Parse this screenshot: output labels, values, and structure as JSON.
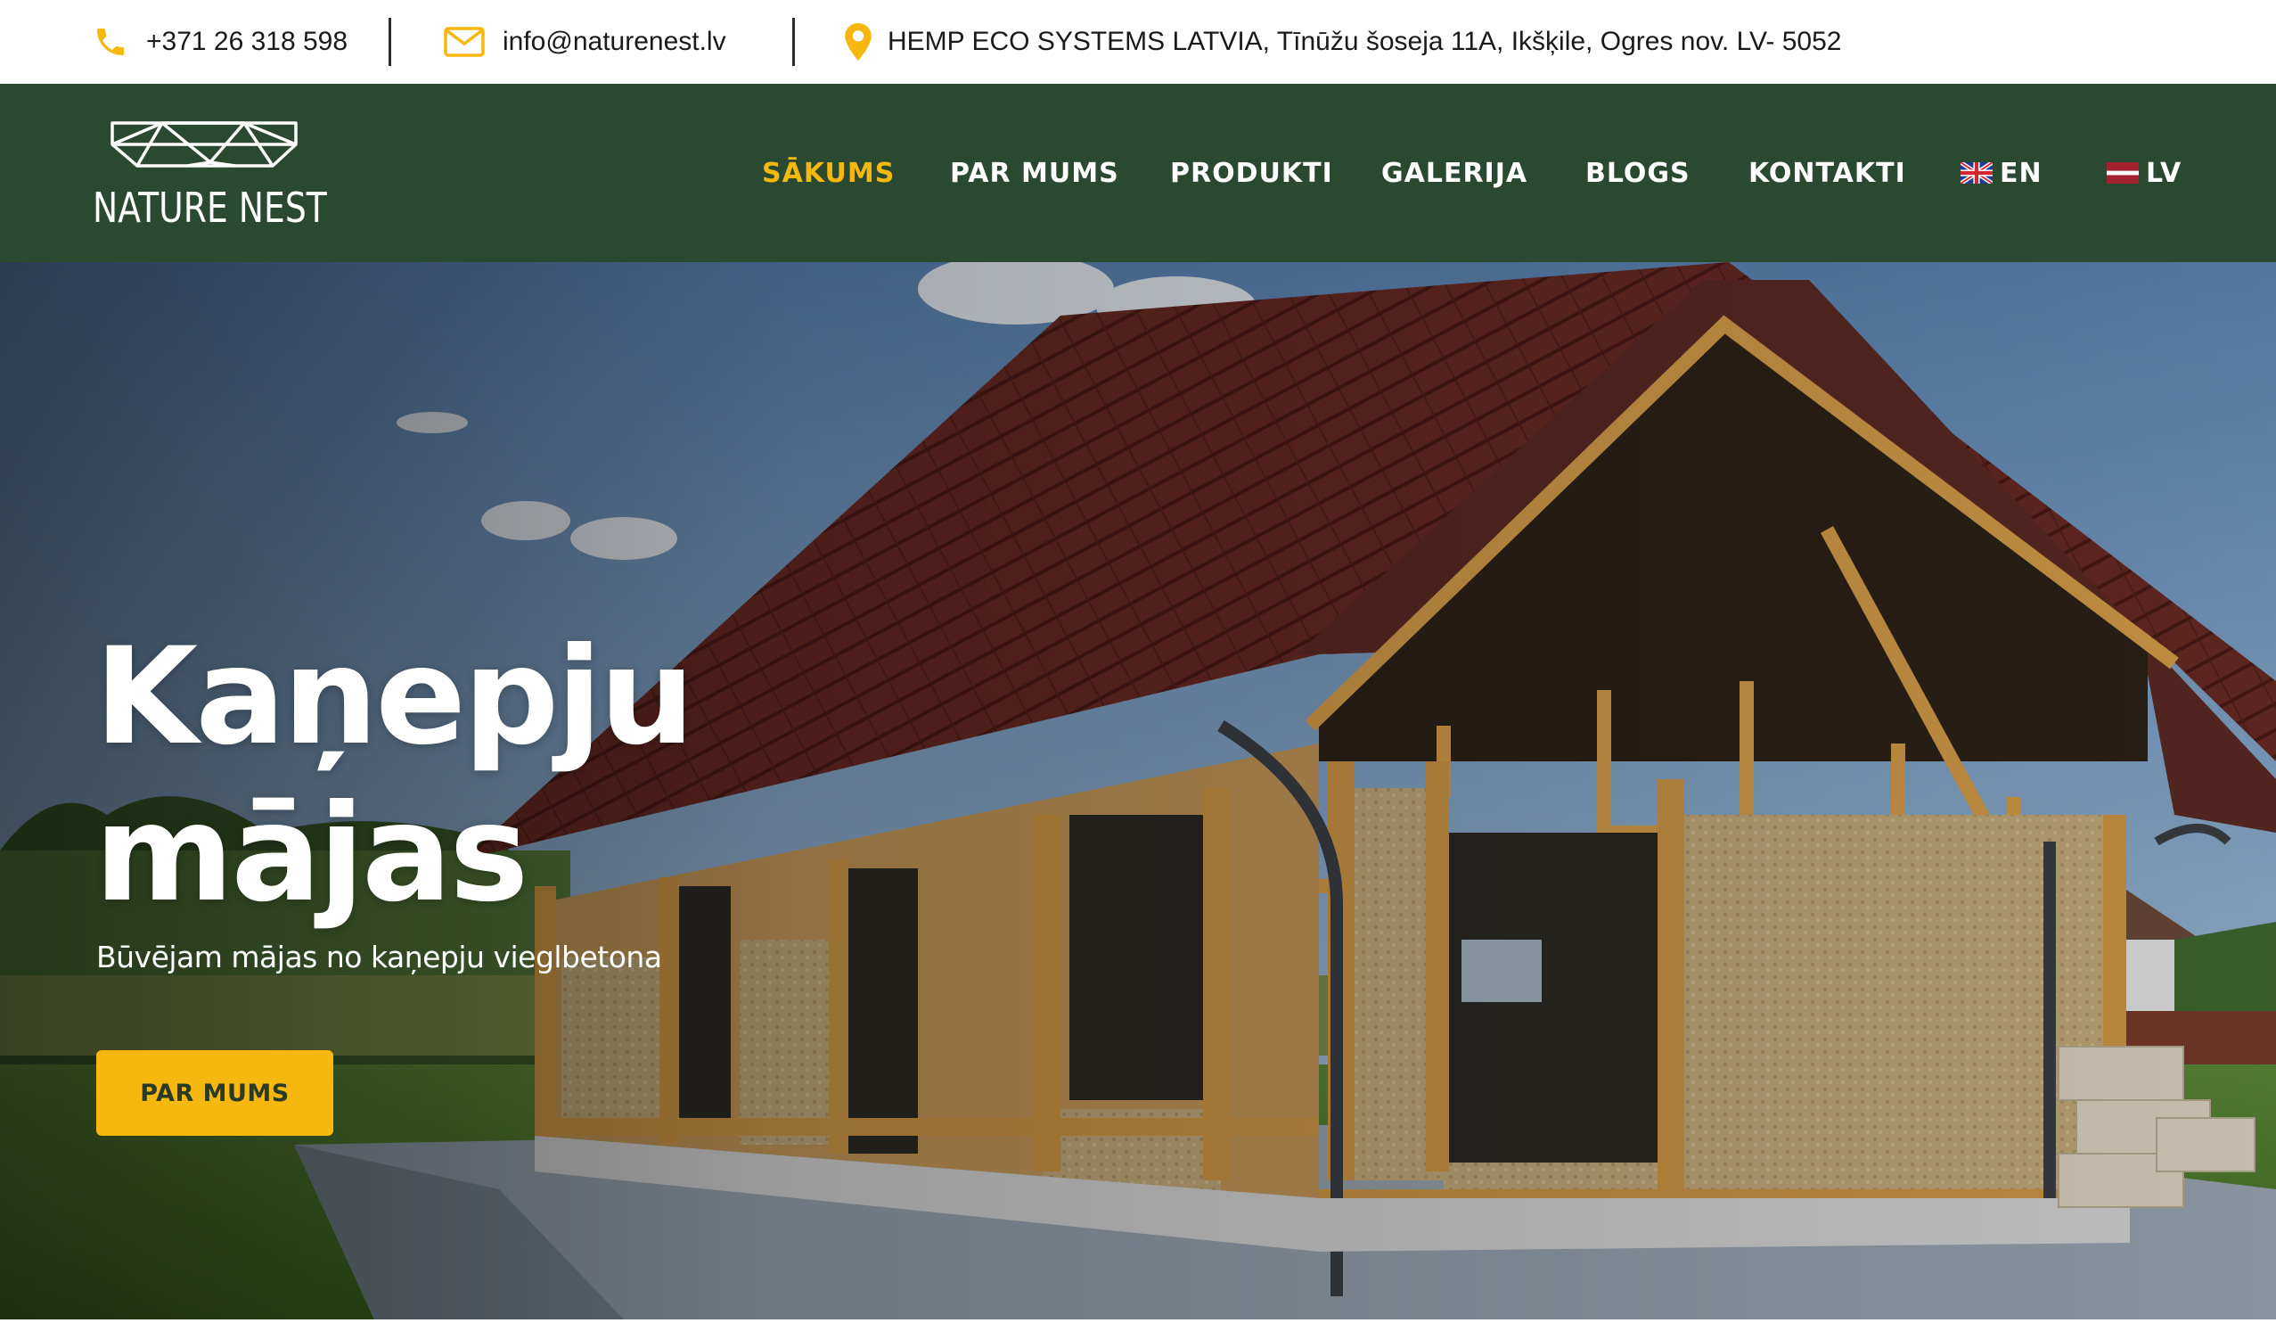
{
  "topbar": {
    "phone": "+371 26 318 598",
    "email": "info@naturenest.lv",
    "address": "HEMP ECO SYSTEMS LATVIA, Tīnūžu šoseja 11A, Ikšķile, Ogres nov. LV- 5052",
    "icons": [
      "phone-icon",
      "mail-icon",
      "location-pin-icon"
    ],
    "icon_color": "#F6B70F"
  },
  "header": {
    "logo_text": "NATURE NEST",
    "nav": [
      {
        "label": "SĀKUMS",
        "active": true
      },
      {
        "label": "PAR MUMS",
        "active": false
      },
      {
        "label": "PRODUKTI",
        "active": false
      },
      {
        "label": "GALERIJA",
        "active": false
      },
      {
        "label": "BLOGS",
        "active": false
      },
      {
        "label": "KONTAKTI",
        "active": false
      }
    ],
    "languages": [
      {
        "label": "EN",
        "flag": "uk-flag-icon"
      },
      {
        "label": "LV",
        "flag": "latvia-flag-icon"
      }
    ],
    "background": "#2A4931",
    "active_color": "#F6B70F"
  },
  "hero": {
    "title_line1": "Kaņepju",
    "title_line2": "mājas",
    "subtitle": "Būvējam mājas no kaņepju vieglbetona",
    "button_label": "PAR MUMS",
    "button_color": "#F6B70F"
  }
}
